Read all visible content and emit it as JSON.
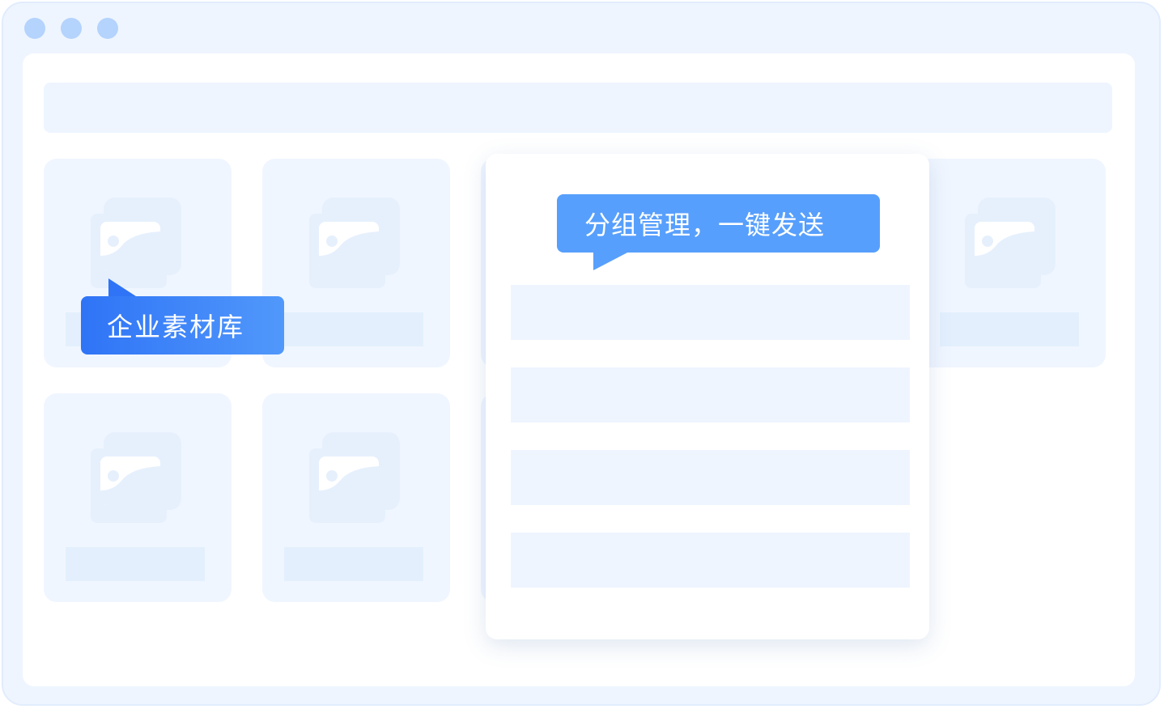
{
  "window": {
    "controls": [
      "close",
      "minimize",
      "maximize"
    ]
  },
  "colors": {
    "accent": "#2f74f6",
    "accent_light": "#579ffc",
    "frame": "#eef5ff",
    "placeholder": "#e3effd"
  },
  "library_badge": {
    "label": "企业素材库"
  },
  "group_badge": {
    "label": "分组管理，一键发送"
  },
  "material_cards": [
    {
      "icon": "image-stack-icon"
    },
    {
      "icon": "image-stack-icon"
    },
    {
      "icon": "image-stack-icon"
    },
    {
      "icon": "image-stack-icon"
    },
    {
      "icon": "image-stack-icon"
    }
  ],
  "group_panel": {
    "row_count": 4
  }
}
